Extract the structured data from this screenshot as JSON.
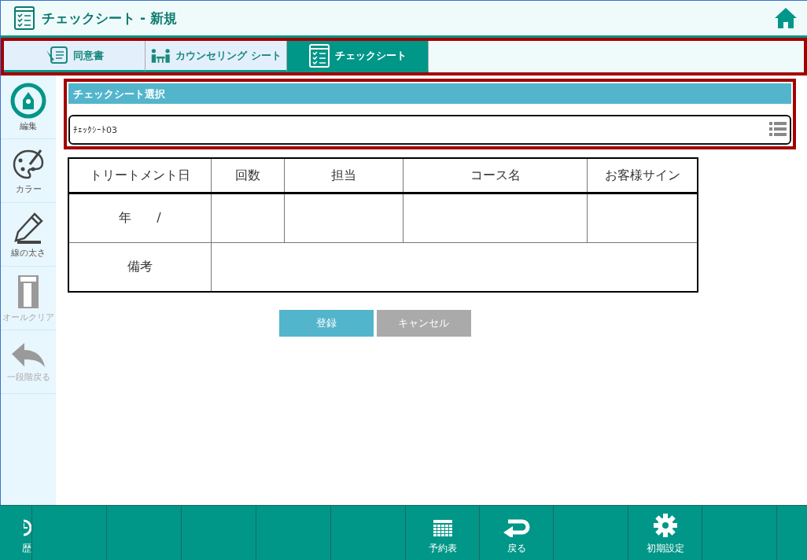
{
  "window": {
    "title": "チェックシート - 新規"
  },
  "tabs": [
    {
      "label": "同意書",
      "selected": false
    },
    {
      "label": "カウンセリング シート",
      "selected": false
    },
    {
      "label": "チェックシート",
      "selected": true
    }
  ],
  "sidebar": {
    "items": [
      {
        "label": "編集",
        "disabled": false
      },
      {
        "label": "カラー",
        "disabled": false
      },
      {
        "label": "線の太さ",
        "disabled": false
      },
      {
        "label": "オールクリア",
        "disabled": true
      },
      {
        "label": "一段階戻る",
        "disabled": true
      }
    ]
  },
  "section": {
    "title": "チェックシート選択",
    "select_value": "ﾁｪｯｸｼｰﾄ03"
  },
  "table": {
    "columns": [
      "トリートメント日",
      "回数",
      "担当",
      "コース名",
      "お客様サイン"
    ],
    "date_cell": "年　　/",
    "remarks_label": "備考"
  },
  "buttons": [
    {
      "label": "登録",
      "disabled": false
    },
    {
      "label": "キャンセル",
      "disabled": true
    }
  ],
  "bottom_bar": [
    {
      "label": "歴"
    },
    {
      "label": "予約表"
    },
    {
      "label": "戻る"
    },
    {
      "label": "初期設定"
    }
  ]
}
